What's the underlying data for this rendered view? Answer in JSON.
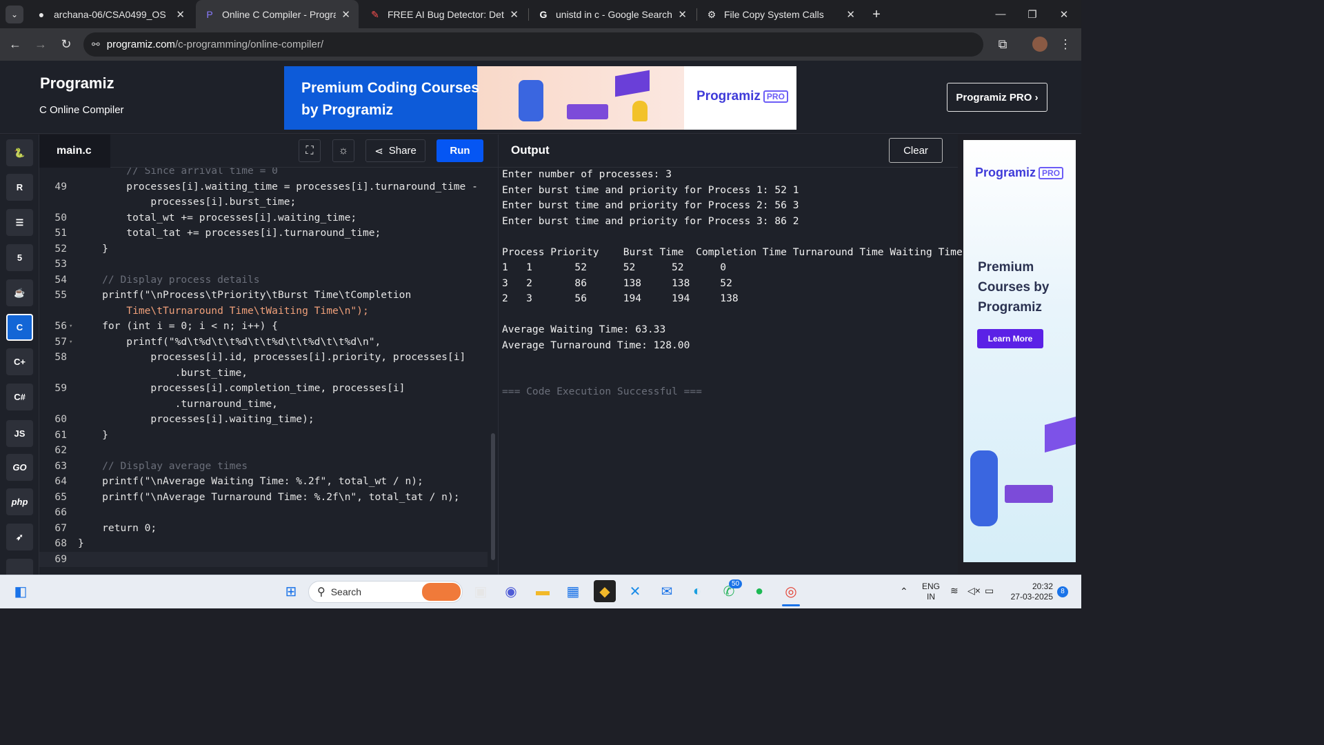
{
  "browser": {
    "tabs": [
      {
        "title": "archana-06/CSA0499_OS",
        "icon": "github-icon"
      },
      {
        "title": "Online C Compiler - Programiz",
        "icon": "programiz-icon",
        "active": true
      },
      {
        "title": "FREE AI Bug Detector: Detect B",
        "icon": "bug-icon"
      },
      {
        "title": "unistd in c - Google Search",
        "icon": "google-icon"
      },
      {
        "title": "File Copy System Calls",
        "icon": "openai-icon"
      }
    ],
    "url_host": "programiz.com",
    "url_path": "/c-programming/online-compiler/"
  },
  "header": {
    "logo": "Programiz",
    "subtitle": "C Online Compiler",
    "banner_text": "Premium Coding Courses by Programiz",
    "banner_logo": "Programiz",
    "banner_badge": "PRO",
    "pro_button": "Programiz PRO ›"
  },
  "sidebar": {
    "languages": [
      "python-icon",
      "r-icon",
      "sql-icon",
      "html-icon",
      "java-icon",
      "c-icon",
      "cpp-icon",
      "csharp-icon",
      "js-icon",
      "go-icon",
      "php-icon",
      "swift-icon",
      "rust-icon"
    ],
    "labels": {
      "js": "JS",
      "go": "GO",
      "php": "php"
    },
    "active": "c-icon"
  },
  "editor": {
    "filename": "main.c",
    "share_label": "Share",
    "run_label": "Run",
    "lines": [
      {
        "num": "",
        "text": "        // Since arrival time = 0"
      },
      {
        "num": "49",
        "text": "        processes[i].waiting_time = processes[i].turnaround_time -"
      },
      {
        "num": "",
        "text": "            processes[i].burst_time;"
      },
      {
        "num": "50",
        "text": "        total_wt += processes[i].waiting_time;"
      },
      {
        "num": "51",
        "text": "        total_tat += processes[i].turnaround_time;"
      },
      {
        "num": "52",
        "text": "    }"
      },
      {
        "num": "53",
        "text": ""
      },
      {
        "num": "54",
        "text": "    // Display process details"
      },
      {
        "num": "55",
        "text": "    printf(\"\\nProcess\\tPriority\\tBurst Time\\tCompletion"
      },
      {
        "num": "",
        "text": "        Time\\tTurnaround Time\\tWaiting Time\\n\");"
      },
      {
        "num": "56",
        "text": "    for (int i = 0; i < n; i++) {"
      },
      {
        "num": "57",
        "text": "        printf(\"%d\\t%d\\t\\t%d\\t\\t%d\\t\\t%d\\t\\t%d\\n\","
      },
      {
        "num": "58",
        "text": "            processes[i].id, processes[i].priority, processes[i]"
      },
      {
        "num": "",
        "text": "                .burst_time,"
      },
      {
        "num": "59",
        "text": "            processes[i].completion_time, processes[i]"
      },
      {
        "num": "",
        "text": "                .turnaround_time,"
      },
      {
        "num": "60",
        "text": "            processes[i].waiting_time);"
      },
      {
        "num": "61",
        "text": "    }"
      },
      {
        "num": "62",
        "text": ""
      },
      {
        "num": "63",
        "text": "    // Display average times"
      },
      {
        "num": "64",
        "text": "    printf(\"\\nAverage Waiting Time: %.2f\", total_wt / n);"
      },
      {
        "num": "65",
        "text": "    printf(\"\\nAverage Turnaround Time: %.2f\\n\", total_tat / n);"
      },
      {
        "num": "66",
        "text": ""
      },
      {
        "num": "67",
        "text": "    return 0;"
      },
      {
        "num": "68",
        "text": "}"
      },
      {
        "num": "69",
        "text": ""
      }
    ]
  },
  "output": {
    "title": "Output",
    "clear_label": "Clear",
    "lines": [
      "Enter number of processes: 3",
      "Enter burst time and priority for Process 1: 52 1",
      "Enter burst time and priority for Process 2: 56 3",
      "Enter burst time and priority for Process 3: 86 2",
      "",
      "Process Priority    Burst Time  Completion Time Turnaround Time Waiting Time",
      "1   1       52      52      52      0",
      "3   2       86      138     138     52",
      "2   3       56      194     194     138",
      "",
      "Average Waiting Time: 63.33",
      "Average Turnaround Time: 128.00",
      "",
      "",
      "=== Code Execution Successful ==="
    ]
  },
  "side_ad": {
    "logo": "Programiz",
    "badge": "PRO",
    "text": "Premium Courses by Programiz",
    "button": "Learn More"
  },
  "taskbar": {
    "search_placeholder": "Search",
    "language": "ENG",
    "region": "IN",
    "time": "20:32",
    "date": "27-03-2025",
    "whatsapp_badge": "50",
    "notification_count": "8"
  }
}
